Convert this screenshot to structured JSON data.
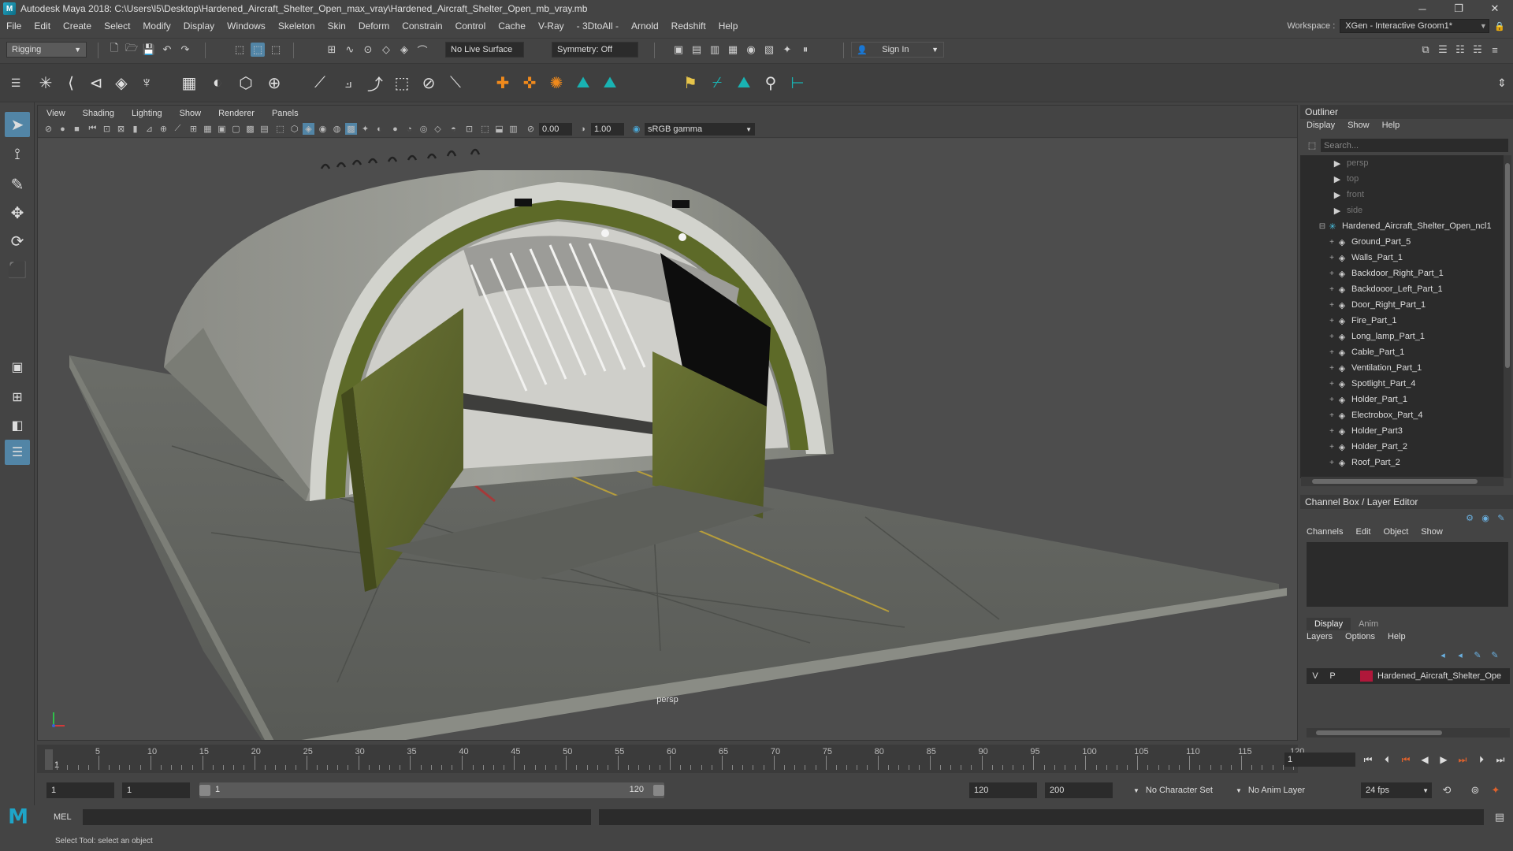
{
  "window": {
    "title": "Autodesk Maya 2018: C:\\Users\\l5\\Desktop\\Hardened_Aircraft_Shelter_Open_max_vray\\Hardened_Aircraft_Shelter_Open_mb_vray.mb",
    "minimize": "─",
    "maximize": "❐",
    "close": "✕"
  },
  "menubar": {
    "items": [
      "File",
      "Edit",
      "Create",
      "Select",
      "Modify",
      "Display",
      "Windows",
      "Skeleton",
      "Skin",
      "Deform",
      "Constrain",
      "Control",
      "Cache",
      "V-Ray",
      "- 3DtoAll -",
      "Arnold",
      "Redshift",
      "Help"
    ],
    "workspace_label": "Workspace :",
    "workspace_value": "XGen - Interactive Groom1*"
  },
  "statusline": {
    "mode": "Rigging",
    "live_surface": "No Live Surface",
    "symmetry": "Symmetry: Off",
    "sign_in": "Sign In"
  },
  "viewport": {
    "menu": [
      "View",
      "Shading",
      "Lighting",
      "Show",
      "Renderer",
      "Panels"
    ],
    "exposure": "0.00",
    "gamma": "1.00",
    "color_space": "sRGB gamma",
    "camera": "persp"
  },
  "outliner": {
    "title": "Outliner",
    "menu": [
      "Display",
      "Show",
      "Help"
    ],
    "search_placeholder": "Search...",
    "items": [
      {
        "label": "persp",
        "type": "camera"
      },
      {
        "label": "top",
        "type": "camera"
      },
      {
        "label": "front",
        "type": "camera"
      },
      {
        "label": "side",
        "type": "camera"
      },
      {
        "label": "Hardened_Aircraft_Shelter_Open_ncl1",
        "type": "group"
      },
      {
        "label": "Ground_Part_5",
        "type": "mesh"
      },
      {
        "label": "Walls_Part_1",
        "type": "mesh"
      },
      {
        "label": "Backdoor_Right_Part_1",
        "type": "mesh"
      },
      {
        "label": "Backdooor_Left_Part_1",
        "type": "mesh"
      },
      {
        "label": "Door_Right_Part_1",
        "type": "mesh"
      },
      {
        "label": "Fire_Part_1",
        "type": "mesh"
      },
      {
        "label": "Long_lamp_Part_1",
        "type": "mesh"
      },
      {
        "label": "Cable_Part_1",
        "type": "mesh"
      },
      {
        "label": "Ventilation_Part_1",
        "type": "mesh"
      },
      {
        "label": "Spotlight_Part_4",
        "type": "mesh"
      },
      {
        "label": "Holder_Part_1",
        "type": "mesh"
      },
      {
        "label": "Electrobox_Part_4",
        "type": "mesh"
      },
      {
        "label": "Holder_Part3",
        "type": "mesh"
      },
      {
        "label": "Holder_Part_2",
        "type": "mesh"
      },
      {
        "label": "Roof_Part_2",
        "type": "mesh"
      }
    ]
  },
  "channelbox": {
    "title": "Channel Box / Layer Editor",
    "menu": [
      "Channels",
      "Edit",
      "Object",
      "Show"
    ]
  },
  "layereditor": {
    "tabs": [
      "Display",
      "Anim"
    ],
    "menu": [
      "Layers",
      "Options",
      "Help"
    ],
    "layer": {
      "v": "V",
      "p": "P",
      "name": "Hardened_Aircraft_Shelter_Ope",
      "color": "#b0173a"
    }
  },
  "timeslider": {
    "labels": [
      "5",
      "10",
      "15",
      "20",
      "25",
      "30",
      "35",
      "40",
      "45",
      "50",
      "55",
      "60",
      "65",
      "70",
      "75",
      "80",
      "85",
      "90",
      "95",
      "100",
      "105",
      "110",
      "115",
      "120"
    ],
    "first": "1",
    "current_frame": "1"
  },
  "rangeslider": {
    "start": "1",
    "anim_start": "1",
    "range_start": "1",
    "range_end": "120",
    "end": "120",
    "anim_end": "200",
    "character_set": "No Character Set",
    "anim_layer": "No Anim Layer",
    "fps": "24 fps"
  },
  "cmdline": {
    "label": "MEL"
  },
  "helpline": {
    "text": "Select Tool: select an object"
  }
}
